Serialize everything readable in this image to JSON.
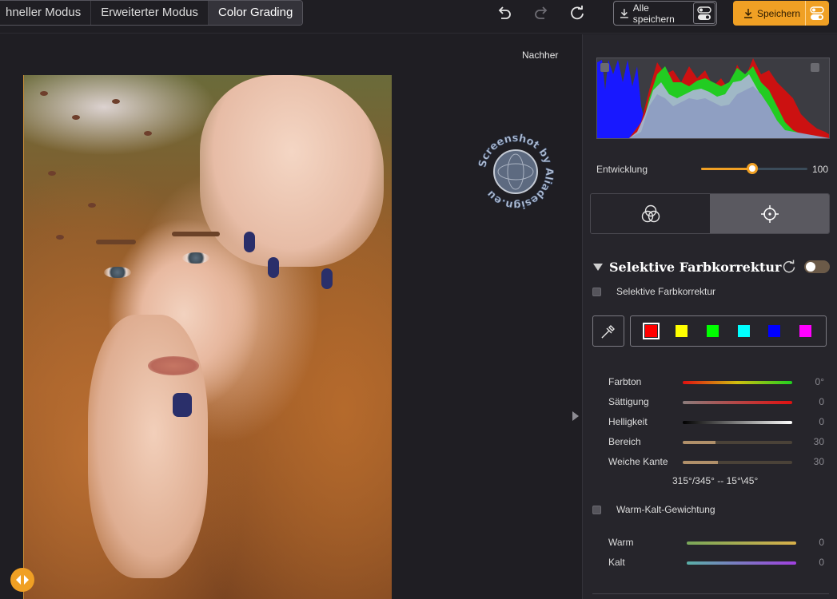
{
  "modes": {
    "quick": "hneller Modus",
    "advanced": "Erweiterter Modus",
    "grading": "Color Grading"
  },
  "toolbar": {
    "undo_icon": "undo-icon",
    "redo_icon": "redo-icon",
    "reset_icon": "reset-icon",
    "save_all_label": "Alle speichern",
    "save_label": "Speichern"
  },
  "canvas": {
    "after_label": "Nachher",
    "watermark_text": "Screenshot by Aliadesign.eu"
  },
  "panel": {
    "development": {
      "label": "Entwicklung",
      "value": "100",
      "fraction": 0.48
    },
    "section_title": "Selektive Farbkorrektur",
    "selective_checkbox_label": "Selektive Farbkorrektur",
    "swatches": [
      "#ff0000",
      "#ffff00",
      "#00ff00",
      "#00ffff",
      "#0000ff",
      "#ff00ff"
    ],
    "sliders": [
      {
        "name": "Farbton",
        "value": "0°"
      },
      {
        "name": "Sättigung",
        "value": "0"
      },
      {
        "name": "Helligkeit",
        "value": "0"
      },
      {
        "name": "Bereich",
        "value": "30"
      },
      {
        "name": "Weiche Kante",
        "value": "30"
      }
    ],
    "range_text": "315°/345° -- 15°\\45°",
    "warmcold_label": "Warm-Kalt-Gewichtung",
    "warm": {
      "name": "Warm",
      "value": "0"
    },
    "cold": {
      "name": "Kalt",
      "value": "0"
    }
  },
  "colors": {
    "accent": "#f0a024",
    "panel": "#26252b",
    "background": "#1f1e23"
  }
}
